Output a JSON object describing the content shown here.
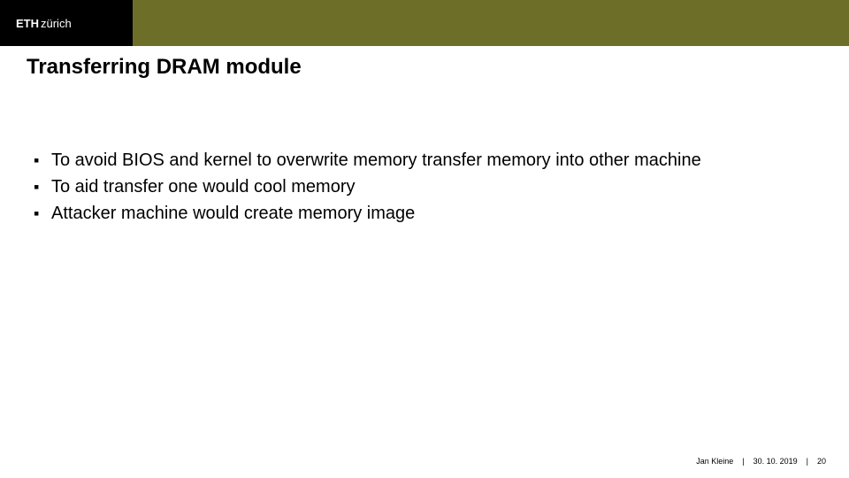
{
  "header": {
    "logo_eth": "ETH",
    "logo_zurich": "zürich"
  },
  "title": "Transferring DRAM module",
  "bullets": [
    "To avoid BIOS and kernel to overwrite memory transfer memory into other machine",
    "To aid transfer one would cool memory",
    "Attacker machine would create memory image"
  ],
  "footer": {
    "author": "Jan Kleine",
    "date": "30. 10. 2019",
    "page": "20",
    "separator": "|"
  }
}
